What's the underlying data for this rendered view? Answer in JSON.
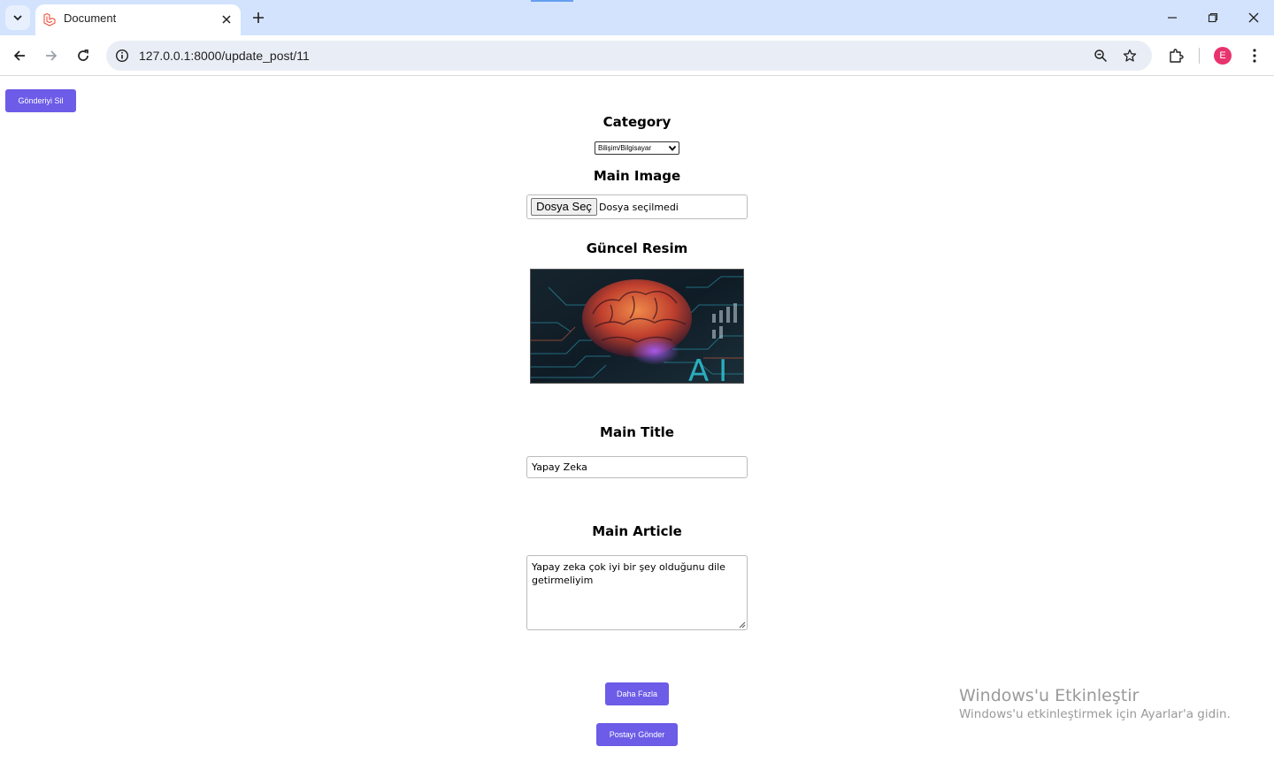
{
  "browser": {
    "tab_title": "Document",
    "url": "127.0.0.1:8000/update_post/11",
    "profile_initial": "E",
    "icons": [
      "tab-search-icon",
      "laravel-favicon-icon",
      "close-icon",
      "plus-icon",
      "minimize-icon",
      "restore-icon",
      "window-close-icon",
      "back-arrow-icon",
      "forward-arrow-icon",
      "reload-icon",
      "site-info-icon",
      "zoom-icon",
      "bookmark-star-icon",
      "extensions-puzzle-icon",
      "kebab-menu-icon"
    ]
  },
  "form": {
    "delete_button": "Gönderiyi Sil",
    "category_heading": "Category",
    "category_selected": "Bilişim/Bilgisayar",
    "main_image_heading": "Main Image",
    "file_button": "Dosya Seç",
    "file_status": "Dosya seçilmedi",
    "current_image_heading": "Güncel Resim",
    "main_title_heading": "Main Title",
    "main_title_value": "Yapay Zeka",
    "main_article_heading": "Main Article",
    "main_article_value": "Yapay zeka çok iyi bir şey olduğunu dile getirmeliyim",
    "more_button": "Daha Fazla",
    "submit_button": "Postayı Gönder"
  },
  "image": {
    "overlay_text": "A I",
    "colors": {
      "accent": "#6c5ce7",
      "brain_orange": "#e0603a",
      "circuit_teal": "#1aa7b8",
      "bg_dark": "#0f1c26"
    }
  },
  "watermark": {
    "line1": "Windows'u Etkinleştir",
    "line2": "Windows'u etkinleştirmek için Ayarlar'a gidin."
  }
}
